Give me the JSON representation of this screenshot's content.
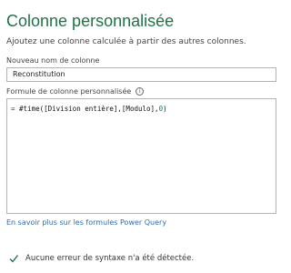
{
  "dialog": {
    "title": "Colonne personnalisée",
    "subtitle": "Ajoutez une colonne calculée à partir des autres colonnes."
  },
  "name_field": {
    "label": "Nouveau nom de colonne",
    "value": "Reconstitution"
  },
  "formula_field": {
    "label": "Formule de colonne personnalisée",
    "info_icon": "info-icon",
    "prefix": "= ",
    "code": "#time([Division entière],[Modulo],",
    "num": "0",
    "suffix": ")"
  },
  "help_link": "En savoir plus sur les formules Power Query",
  "status": {
    "icon": "check-icon",
    "text": "Aucune erreur de syntaxe n'a été détectée.",
    "color": "#217346"
  },
  "colors": {
    "title": "#217346",
    "link": "#2b6cb0"
  }
}
